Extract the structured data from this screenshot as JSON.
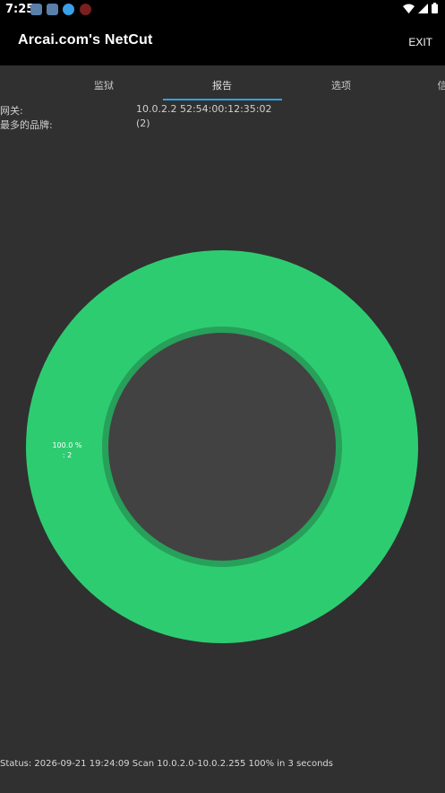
{
  "statusbar": {
    "time": "7:25"
  },
  "appbar": {
    "title": "Arcai.com's NetCut",
    "exit_label": "EXIT"
  },
  "tabs": [
    {
      "label": "监狱"
    },
    {
      "label": "报告",
      "selected": true
    },
    {
      "label": "选项"
    },
    {
      "label": "信"
    }
  ],
  "info": {
    "gateway_label": "网关:",
    "gateway_value": "10.0.2.2 52:54:00:12:35:02",
    "brand_label": "最多的品牌:",
    "brand_value": "(2)"
  },
  "chart_data": {
    "type": "pie",
    "style": "donut",
    "slices": [
      {
        "label": "",
        "percent": 100.0,
        "value": 2,
        "color": "#2ecc71"
      }
    ],
    "slice_label_line1": "100.0 %",
    "slice_label_line2": ": 2",
    "hole_color": "#424242",
    "hole_ring_color": "#27a05a"
  },
  "status": {
    "text": "Status: 2026-09-21 19:24:09 Scan 10.0.2.0-10.0.2.255  100% in 3 seconds"
  }
}
